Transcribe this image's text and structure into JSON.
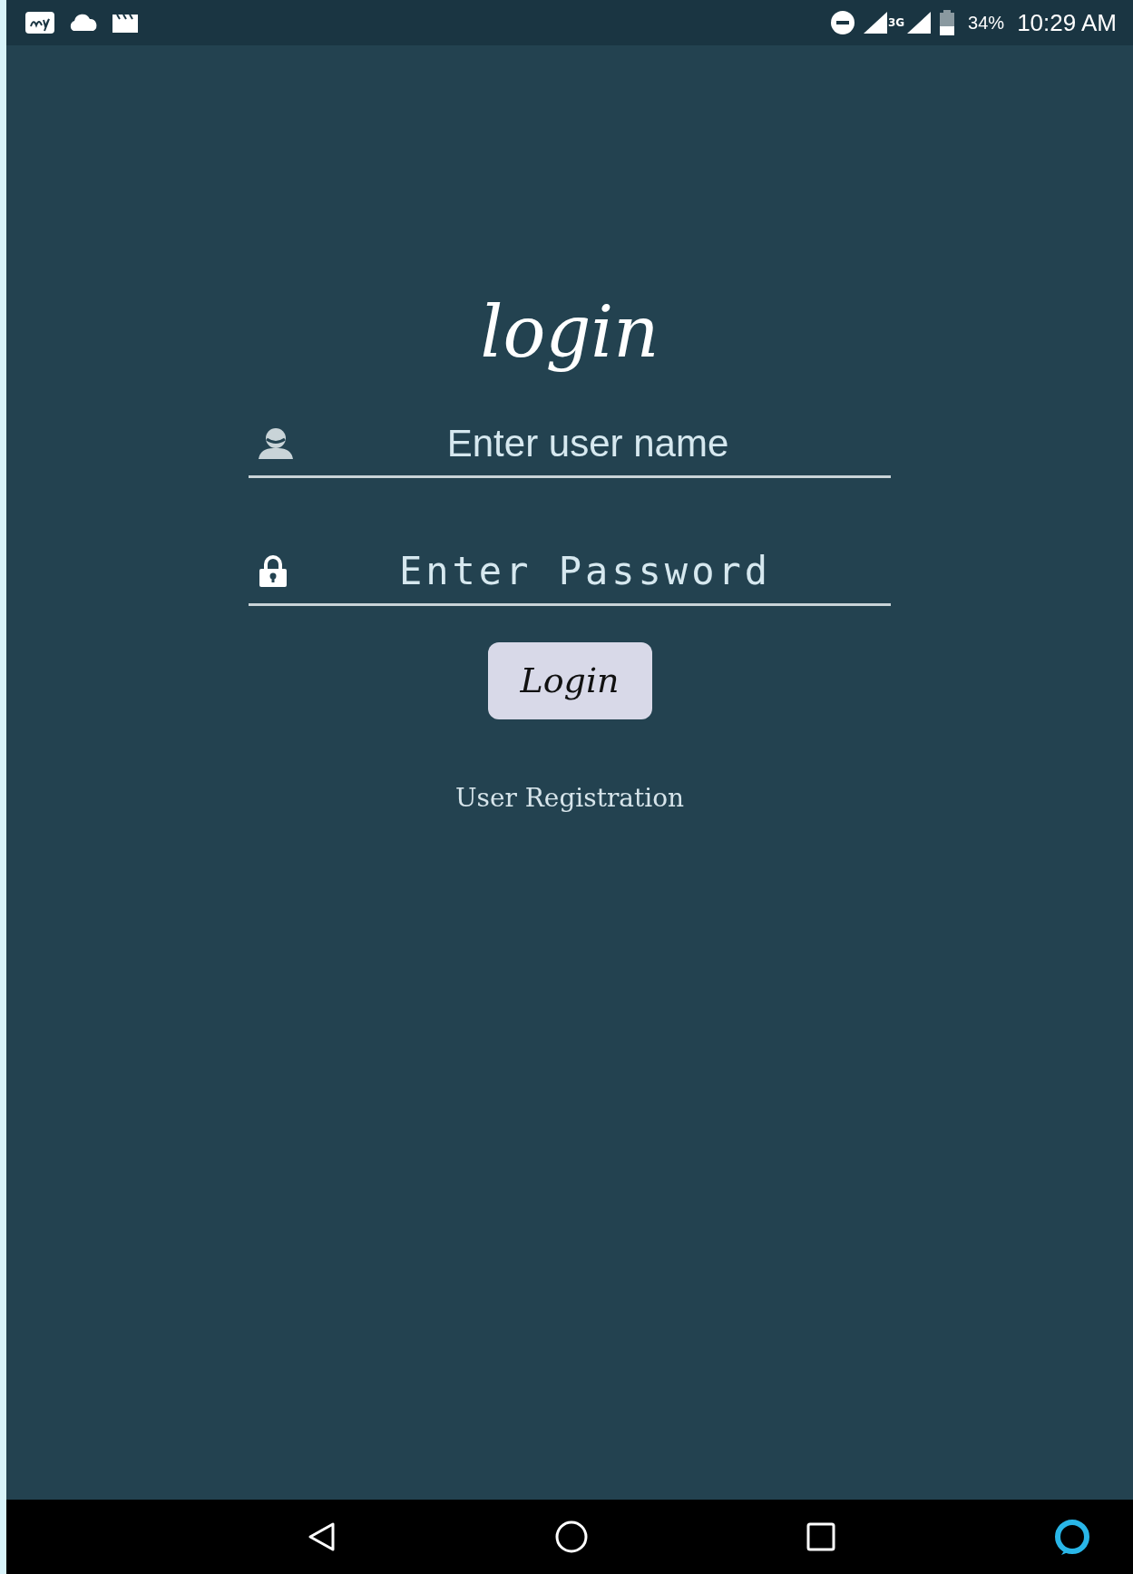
{
  "status_bar": {
    "network": "3G",
    "battery": "34%",
    "time": "10:29 AM"
  },
  "title": "login",
  "fields": [
    {
      "kind": "user",
      "placeholder": "Enter user name"
    },
    {
      "kind": "password",
      "placeholder": "Enter Password"
    }
  ],
  "button": "Login",
  "link": "User Registration"
}
